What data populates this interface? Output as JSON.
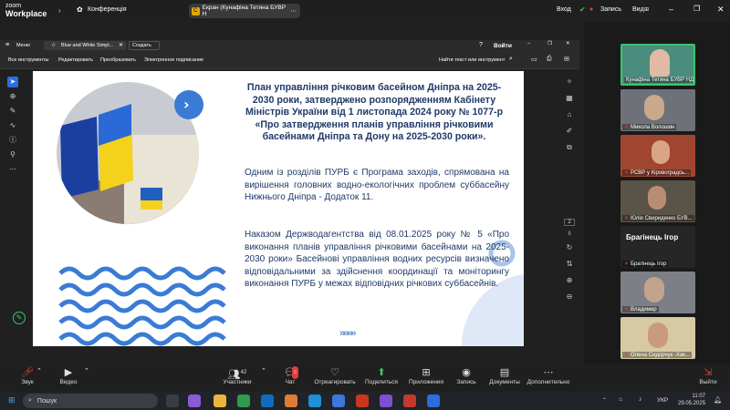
{
  "topbar": {
    "brand_line1": "zoom",
    "brand_line2": "Workplace",
    "conference": "Конференція",
    "share_pill": "Екран (Кунафіна Тетяна БУВР Н",
    "login": "Вход",
    "record": "Запись",
    "view": "Вид"
  },
  "acrobat": {
    "menu": "Меню",
    "tab_title": "Blue and White Simpl...",
    "create": "Создать",
    "signin": "Войти",
    "tools": [
      "Все инструменты",
      "Редактировать",
      "Преобразовать",
      "Электронное подписание"
    ],
    "search": "Найти текст или инструмент",
    "page_current": "2",
    "page_total": "8"
  },
  "slide": {
    "title": "План управління річковим басейном Дніпра на 2025-2030 роки, затверджено розпорядженням Кабінету Міністрів України від 1 листопада 2024 року № 1077-р «Про затвердження планів управління річковими басейнами Дніпра та Дону на 2025-2030 роки».",
    "para1": "Одним із розділів ПУРБ є Програма заходів, спрямована на вирішення головних водно-екологічних проблем суббасейну Нижнього Дніпра - Додаток 11.",
    "para2": "Наказом Держводагентства від 08.01.2025 року № 5 «Про виконання планів управління річковими басейнами на 2025-2030 роки» Басейнові управління водних ресурсів визначено відповідальними за здійснення координації та моніторингу виконання ПУРБ у межах відповідних річкових суббасейнів.",
    "chevrons": "»»»»"
  },
  "gallery": {
    "participants": [
      "Кунафіна Тетяна БУВР НД",
      "Микола Волошин",
      "РСВР у Кіровоградсь...",
      "Юлія Свириденко БУВ...",
      "Брагінець Ігор",
      "Брагінець Ігор",
      "Владимир",
      "Олена Сидорчук -Хак..."
    ]
  },
  "toolbar": {
    "mute": "Звук",
    "video": "Видео",
    "participants": "Участники",
    "participants_count": "42",
    "chat": "Чат",
    "chat_badge": "3",
    "react": "Отреагировать",
    "share": "Поделиться",
    "apps": "Приложения",
    "record": "Запись",
    "docs": "Документы",
    "more": "Дополнительно",
    "leave": "Выйти"
  },
  "taskbar": {
    "search": "Пошук",
    "lang": "УКР",
    "time": "11:07",
    "date": "29.05.2025"
  },
  "colors": {
    "accent": "#2d6cdf",
    "slide_text": "#1f3a68",
    "wave_blue": "#3a7bd5",
    "leave_red": "#e23d3d"
  }
}
